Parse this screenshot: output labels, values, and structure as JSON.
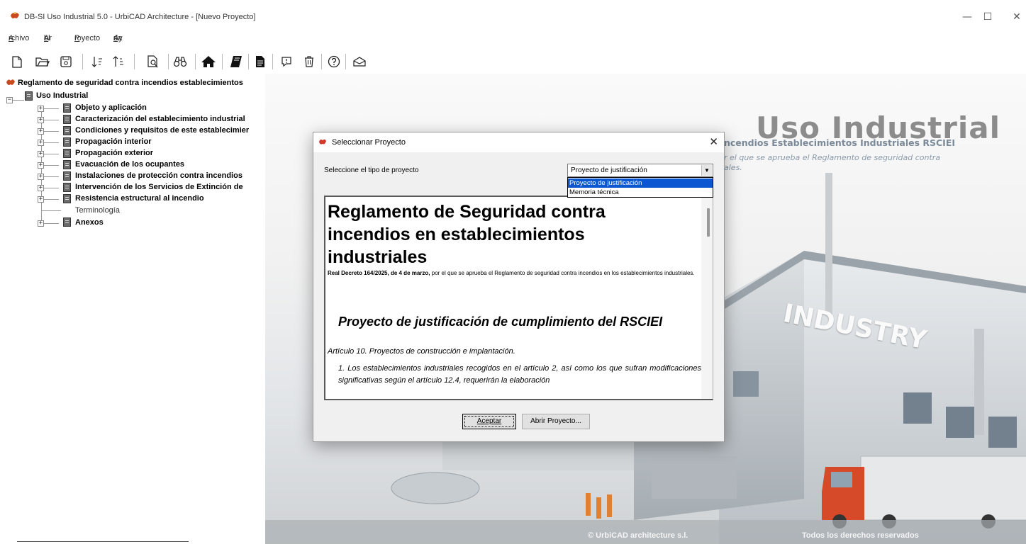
{
  "window": {
    "title": "DB-SI Uso Industrial 5.0 - UrbiCAD Architecture - [Nuevo Proyecto]",
    "minimize": "—",
    "maximize": "☐",
    "close": "✕"
  },
  "menu": {
    "items": [
      {
        "label": "Archivo",
        "accel": "A"
      },
      {
        "label": "Arbol",
        "accel": "b"
      },
      {
        "label": "Proyecto",
        "accel": "P"
      },
      {
        "label": "Ayuda",
        "accel": "u"
      }
    ]
  },
  "toolbar": {
    "icons": [
      "new-file-icon",
      "open-folder-icon",
      "save-icon",
      "sort-ascending-icon",
      "sort-descending-icon",
      "print-preview-icon",
      "binoculars-icon",
      "home-icon",
      "book-icon",
      "document-icon",
      "comment-icon",
      "delete-icon",
      "help-icon",
      "package-icon"
    ]
  },
  "tree": {
    "root": "Reglamento de seguridad contra incendios establecimientos",
    "group": "Uso Industrial",
    "items": [
      "Objeto y aplicación",
      "Caracterización del establecimiento industrial",
      "Condiciones y requisitos de este establecimier",
      "Propagación interior",
      "Propagación exterior",
      "Evacuación de los ocupantes",
      "Instalaciones de protección contra incendios",
      "Intervención de los Servicios de Extinción de",
      "Resistencia estructural al incendio"
    ],
    "leaf": "Terminología",
    "last": "Anexos"
  },
  "background": {
    "headline": "Uso Industrial",
    "subhead": "ncendios Establecimientos Industriales RSCIEI",
    "desc_line1": "r el que se aprueba el Reglamento de seguridad contra",
    "desc_line2": "ales.",
    "sign": "INDUSTRY",
    "footer_left": "© UrbiCAD architecture s.l.",
    "footer_right": "Todos los derechos reservados"
  },
  "dialog": {
    "title": "Seleccionar Proyecto",
    "label": "Seleccione el tipo de proyecto",
    "combo_value": "Proyecto de justificación",
    "options": [
      "Proyecto de justificación",
      "Memoria técnica"
    ],
    "doc": {
      "h1_line1": "Reglamento de Seguridad contra",
      "h1_line2": "incendios en establecimientos",
      "h1_line3": "industriales",
      "decree_bold": "Real Decreto 164/2025, de 4 de marzo,",
      "decree_rest": " por el que se aprueba el Reglamento de seguridad contra incendios en los establecimientos industriales.",
      "h2": "Proyecto de justificación de cumplimiento del RSCIEI",
      "article": "Artículo 10.   Proyectos de construcción e implantación.",
      "para1": "1.   Los establecimientos industriales recogidos en el artículo 2, así como los que sufran modificaciones significativas según el artículo 12.4, requerirán la elaboración"
    },
    "btn_accept": "Aceptar",
    "btn_open": "Abrir Proyecto..."
  },
  "colors": {
    "selection": "#0a57d1",
    "dialog_bg": "#f0f0f0"
  }
}
